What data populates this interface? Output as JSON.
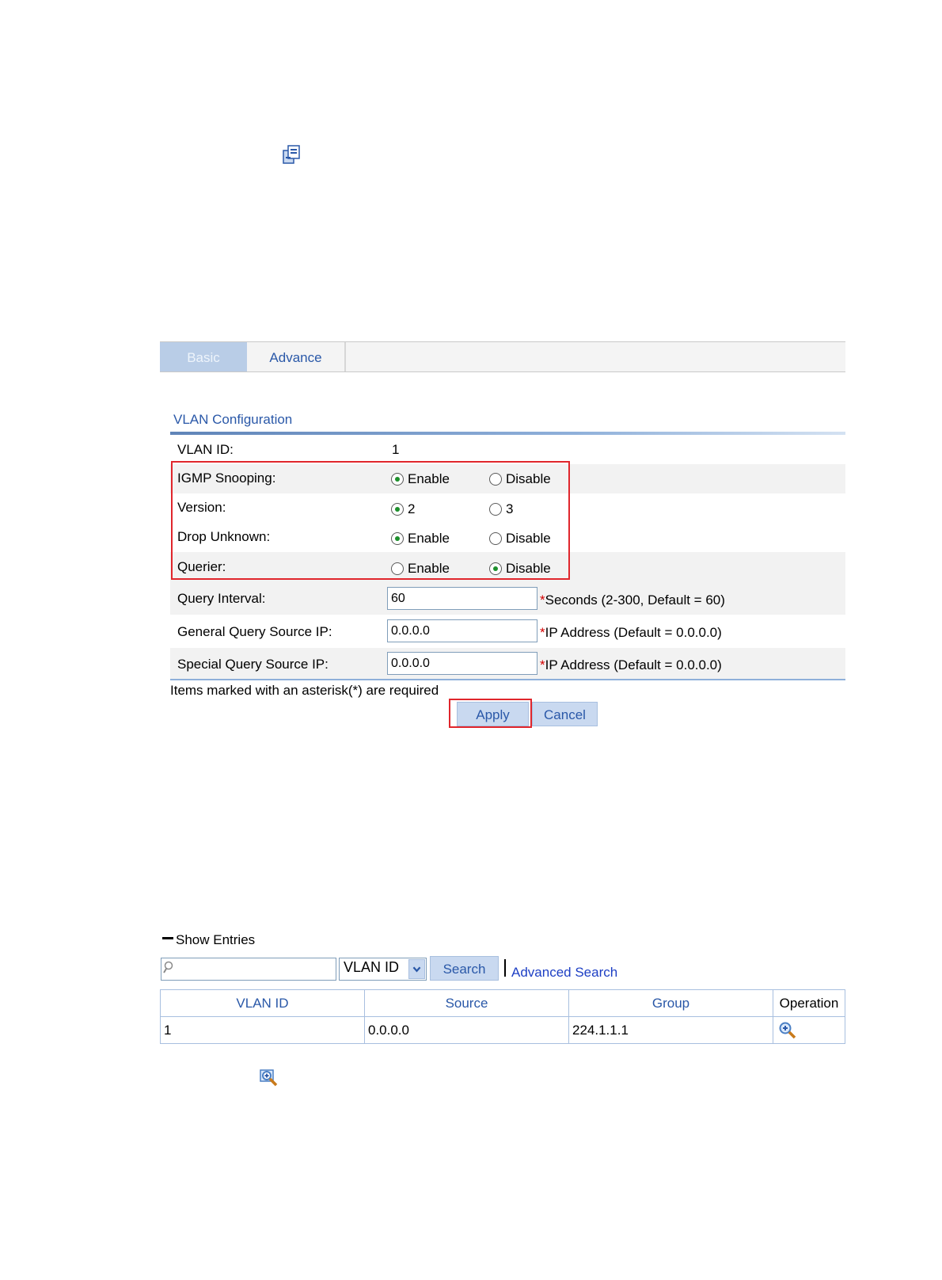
{
  "tabs": [
    {
      "label": "Basic",
      "active": true
    },
    {
      "label": "Advance",
      "active": false
    }
  ],
  "section": {
    "title": "VLAN Configuration"
  },
  "vlan": {
    "label": "VLAN ID:",
    "value": "1"
  },
  "options": {
    "igmp": {
      "label": "IGMP Snooping:",
      "opt1": "Enable",
      "opt2": "Disable",
      "selected": "Enable"
    },
    "version": {
      "label": "Version:",
      "opt1": "2",
      "opt2": "3",
      "selected": "2"
    },
    "drop": {
      "label": "Drop Unknown:",
      "opt1": "Enable",
      "opt2": "Disable",
      "selected": "Enable"
    },
    "querier": {
      "label": "Querier:",
      "opt1": "Enable",
      "opt2": "Disable",
      "selected": "Disable"
    }
  },
  "fields": {
    "query_interval": {
      "label": "Query Interval:",
      "value": "60",
      "hint": "Seconds (2-300, Default = 60)"
    },
    "general_ip": {
      "label": "General Query Source IP:",
      "value": "0.0.0.0",
      "hint": "IP Address (Default = 0.0.0.0)"
    },
    "special_ip": {
      "label": "Special Query Source IP:",
      "value": "0.0.0.0",
      "hint": "IP Address (Default = 0.0.0.0)"
    }
  },
  "asterisk": "*",
  "required_note": "Items marked with an asterisk(*) are required",
  "buttons": {
    "apply": "Apply",
    "cancel": "Cancel"
  },
  "entries": {
    "title": "Show Entries",
    "search_value": "",
    "filter_selected": "VLAN ID",
    "search_button": "Search",
    "advanced_search": "Advanced Search",
    "columns": [
      "VLAN ID",
      "Source",
      "Group",
      "Operation"
    ],
    "rows": [
      {
        "vlan_id": "1",
        "source": "0.0.0.0",
        "group": "224.1.1.1",
        "operation_icon": "zoom-icon"
      }
    ]
  },
  "colors": {
    "highlight": "#e0262c",
    "link": "#2a58a8",
    "radio_selected": "#1d8f2c"
  }
}
